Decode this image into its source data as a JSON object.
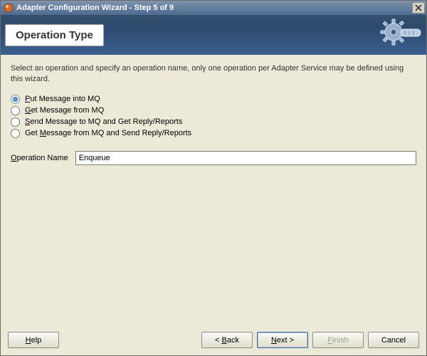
{
  "titlebar": {
    "title": "Adapter Configuration Wizard - Step 5 of 9"
  },
  "header": {
    "title": "Operation Type"
  },
  "instruction": "Select an operation and specify an operation name, only one operation per Adapter Service may be defined using this wizard.",
  "radios": {
    "put": {
      "pre": "",
      "mn": "P",
      "post": "ut Message into MQ"
    },
    "get": {
      "pre": "",
      "mn": "G",
      "post": "et Message from MQ"
    },
    "send": {
      "pre": "",
      "mn": "S",
      "post": "end Message to MQ and Get Reply/Reports"
    },
    "getr": {
      "pre": "Get ",
      "mn": "M",
      "post": "essage from MQ and Send Reply/Reports"
    }
  },
  "operation": {
    "label_pre": "",
    "label_mn": "O",
    "label_post": "peration Name",
    "value": "Enqueue"
  },
  "buttons": {
    "help": {
      "mn": "H",
      "post": "elp"
    },
    "back": {
      "pre": "< ",
      "mn": "B",
      "post": "ack"
    },
    "next": {
      "mn": "N",
      "post": "ext >"
    },
    "finish": {
      "mn": "F",
      "post": "inish"
    },
    "cancel": "Cancel"
  }
}
